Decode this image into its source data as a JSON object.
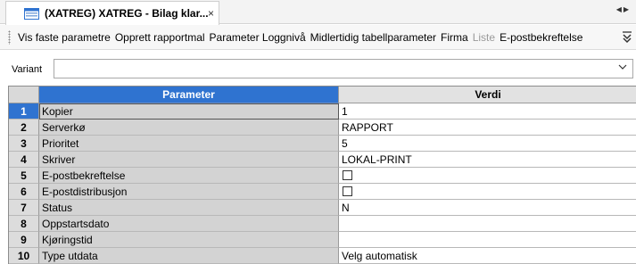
{
  "tab": {
    "title": "(XATREG) XATREG - Bilag klar...",
    "close_glyph": "×",
    "scroll_left_glyph": "◀",
    "scroll_right_glyph": "▶",
    "icon": "window-icon"
  },
  "toolbar": {
    "items": [
      {
        "label": "Vis faste parametre",
        "enabled": true
      },
      {
        "label": "Opprett rapportmal",
        "enabled": true
      },
      {
        "label": "Parameter Loggnivå",
        "enabled": true
      },
      {
        "label": "Midlertidig tabellparameter",
        "enabled": true
      },
      {
        "label": "Firma",
        "enabled": true
      },
      {
        "label": "Liste",
        "enabled": false
      },
      {
        "label": "E-postbekreftelse",
        "enabled": true
      }
    ],
    "overflow_icon": "chevron-double-down-icon"
  },
  "variant": {
    "label": "Variant",
    "value": ""
  },
  "grid": {
    "columns": {
      "parameter": "Parameter",
      "value": "Verdi"
    },
    "selected_row": 1,
    "rows": [
      {
        "num": "1",
        "name": "Kopier",
        "value": "1",
        "type": "text"
      },
      {
        "num": "2",
        "name": "Serverkø",
        "value": "RAPPORT",
        "type": "text"
      },
      {
        "num": "3",
        "name": "Prioritet",
        "value": "5",
        "type": "text"
      },
      {
        "num": "4",
        "name": "Skriver",
        "value": "LOKAL-PRINT",
        "type": "text"
      },
      {
        "num": "5",
        "name": "E-postbekreftelse",
        "value": "",
        "type": "checkbox",
        "checked": false
      },
      {
        "num": "6",
        "name": "E-postdistribusjon",
        "value": "",
        "type": "checkbox",
        "checked": false
      },
      {
        "num": "7",
        "name": "Status",
        "value": "N",
        "type": "text"
      },
      {
        "num": "8",
        "name": "Oppstartsdato",
        "value": "",
        "type": "text"
      },
      {
        "num": "9",
        "name": "Kjøringstid",
        "value": "",
        "type": "text"
      },
      {
        "num": "10",
        "name": "Type utdata",
        "value": "Velg automatisk",
        "type": "text"
      }
    ]
  },
  "colors": {
    "accent": "#2f73d0",
    "param_cell_bg": "#d3d3d3",
    "disabled_text": "#9a9a9a"
  }
}
